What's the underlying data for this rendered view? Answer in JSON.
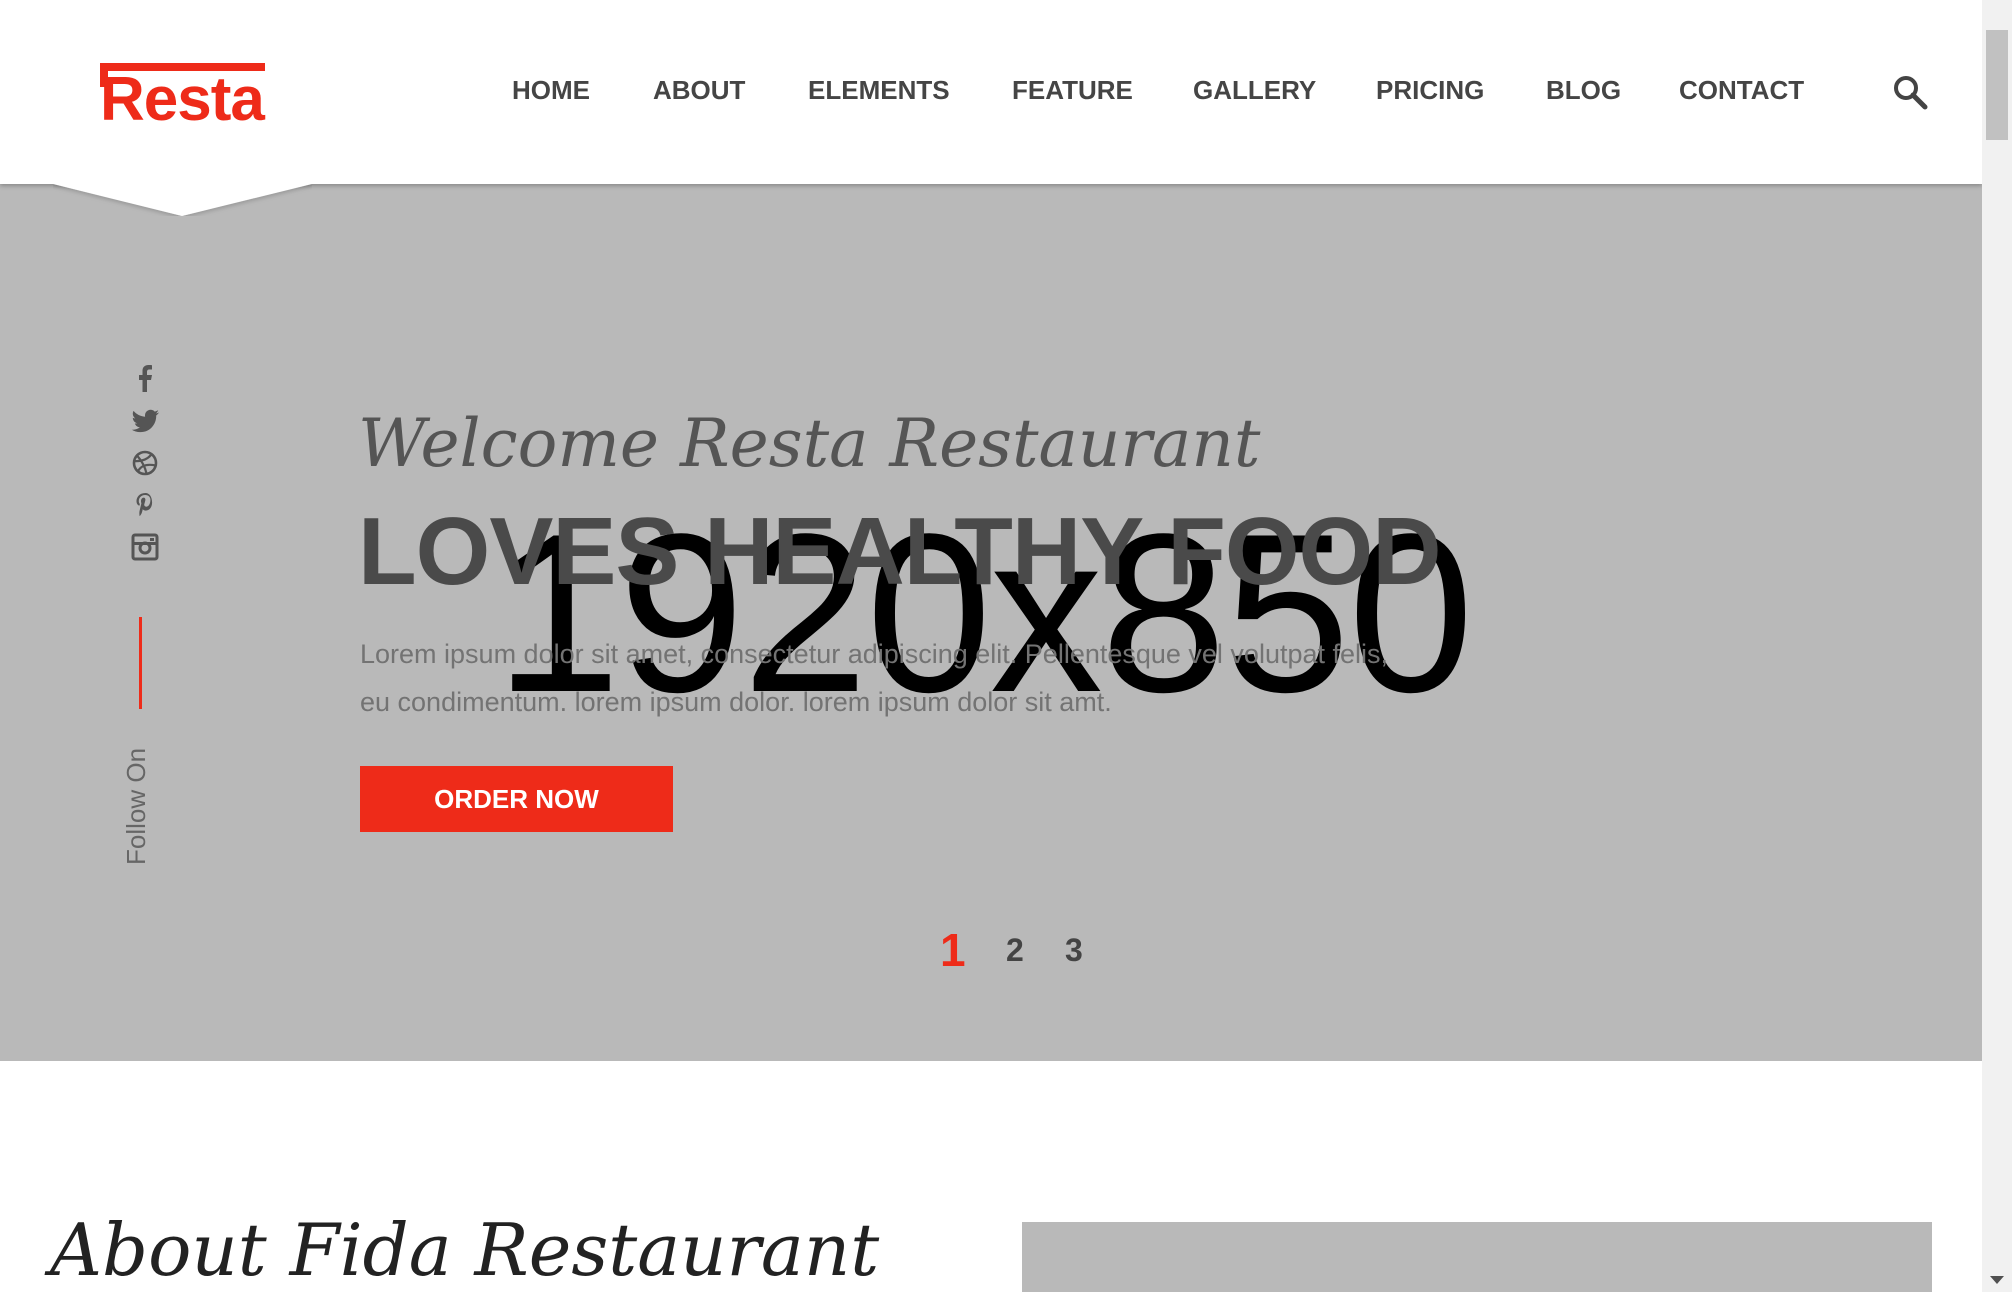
{
  "brand": {
    "logo_text": "Resta",
    "accent_color": "#ee2b19"
  },
  "nav": {
    "items": [
      {
        "label": "HOME"
      },
      {
        "label": "ABOUT"
      },
      {
        "label": "ELEMENTS"
      },
      {
        "label": "FEATURE"
      },
      {
        "label": "GALLERY"
      },
      {
        "label": "PRICING"
      },
      {
        "label": "BLOG"
      },
      {
        "label": "CONTACT"
      }
    ],
    "search_icon": "search-icon"
  },
  "hero": {
    "placeholder_text": "1920x850",
    "welcome": "Welcome Resta Restaurant",
    "headline": "LOVES HEALTHY FOOD",
    "description_line1": "Lorem ipsum dolor sit amet, consectetur adipiscing elit. Pellentesque vel volutpat felis,",
    "description_line2": "eu condimentum. lorem ipsum dolor. lorem ipsum dolor sit amt.",
    "cta_label": "ORDER NOW",
    "background_color": "#b9b9b9",
    "social": {
      "follow_label": "Follow On",
      "icons": [
        "facebook-icon",
        "twitter-icon",
        "dribbble-icon",
        "pinterest-icon",
        "instagram-icon"
      ]
    },
    "pager": {
      "pages": [
        "1",
        "2",
        "3"
      ],
      "active": "1"
    }
  },
  "about": {
    "title": "About Fida Restaurant"
  }
}
